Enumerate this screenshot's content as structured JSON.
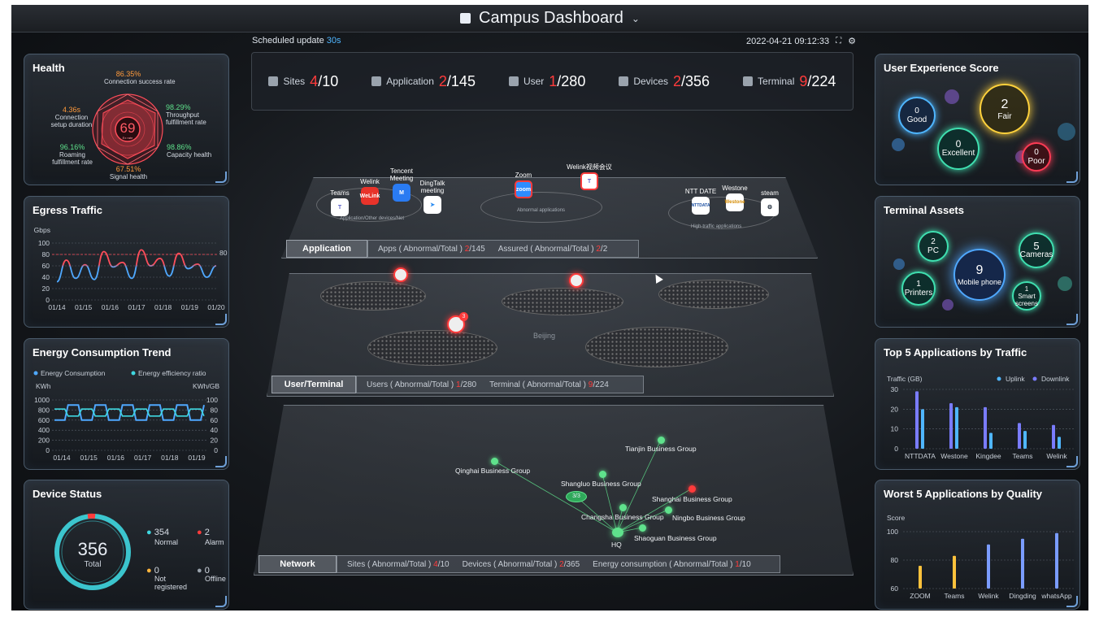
{
  "header": {
    "title": "Campus Dashboard",
    "scheduled_label": "Scheduled update",
    "scheduled_value": "30s",
    "datetime": "2022-04-21 09:12:33"
  },
  "stats": [
    {
      "label": "Sites",
      "abnormal": "4",
      "total": "/10",
      "icon": "building-icon"
    },
    {
      "label": "Application",
      "abnormal": "2",
      "total": "/145",
      "icon": "grid-icon"
    },
    {
      "label": "User",
      "abnormal": "1",
      "total": "/280",
      "icon": "person-icon"
    },
    {
      "label": "Devices",
      "abnormal": "2",
      "total": "/356",
      "icon": "server-icon"
    },
    {
      "label": "Terminal",
      "abnormal": "9",
      "total": "/224",
      "icon": "monitor-icon"
    }
  ],
  "health": {
    "title": "Health",
    "score": "69",
    "score_sub": "Ex rate",
    "metrics": {
      "conn_success": {
        "value": "86.35%",
        "label": "Connection success rate"
      },
      "setup": {
        "value": "4.36s",
        "label": "Connection setup duration"
      },
      "throughput": {
        "value": "98.29%",
        "label": "Throughput fulfillment rate"
      },
      "roaming": {
        "value": "96.16%",
        "label": "Roaming fulfillment rate"
      },
      "capacity": {
        "value": "98.86%",
        "label": "Capacity health"
      },
      "signal": {
        "value": "67.51%",
        "label": "Signal health"
      }
    }
  },
  "egress": {
    "title": "Egress Traffic",
    "unit": "Gbps",
    "threshold_label": "80"
  },
  "energy": {
    "title": "Energy Consumption Trend",
    "legend1": "Energy Consumption",
    "legend2": "Energy efficiency ratio",
    "unit_left": "KWh",
    "unit_right": "KWh/GB"
  },
  "device_status": {
    "title": "Device Status",
    "total": "356",
    "total_label": "Total",
    "normal": "354",
    "normal_label": "Normal",
    "alarm": "2",
    "alarm_label": "Alarm",
    "not_registered": "0",
    "not_registered_label": "Not registered",
    "offline": "0",
    "offline_label": "Offline"
  },
  "ux": {
    "title": "User Experience Score",
    "good": "0",
    "good_label": "Good",
    "fair": "2",
    "fair_label": "Fair",
    "excellent": "0",
    "excellent_label": "Excellent",
    "poor": "0",
    "poor_label": "Poor"
  },
  "assets": {
    "title": "Terminal Assets",
    "pc": "2",
    "pc_label": "PC",
    "cameras": "5",
    "cameras_label": "Cameras",
    "printers": "1",
    "printers_label": "Printers",
    "mobile": "9",
    "mobile_label": "Mobile phone",
    "smart": "1",
    "smart_label": "Smart screens"
  },
  "top5": {
    "title": "Top 5 Applications by Traffic",
    "unit": "Traffic (GB)",
    "uplink": "Uplink",
    "downlink": "Downlink"
  },
  "worst5": {
    "title": "Worst 5 Applications by Quality",
    "unit": "Score"
  },
  "layers": {
    "application": {
      "tab": "Application",
      "info1": "Apps ( Abnormal/Total )",
      "info1_a": "2",
      "info1_t": "/145",
      "info2": "Assured ( Abnormal/Total )",
      "info2_a": "2",
      "info2_t": "/2",
      "apps": {
        "teams": "Teams",
        "welink": "Welink",
        "tencent": "Tencent Meeting",
        "dingtalk": "DingTalk meeting",
        "zoom": "Zoom",
        "welink_video": "Welink视频会议",
        "ntt": "NTT DATE",
        "westone": "Westone",
        "steam": "steam"
      },
      "groups": {
        "g1": "Application/Other devices/Net",
        "g2": "Abnormal applications",
        "g3": "High-traffic applications"
      }
    },
    "user": {
      "tab": "User/Terminal",
      "info1": "Users ( Abnormal/Total )",
      "info1_a": "1",
      "info1_t": "/280",
      "info2": "Terminal ( Abnormal/Total )",
      "info2_a": "9",
      "info2_t": "/224",
      "city": "Beijing",
      "badge": "3"
    },
    "network": {
      "tab": "Network",
      "info1": "Sites ( Abnormal/Total )",
      "info1_a": "4",
      "info1_t": "/10",
      "info2": "Devices ( Abnormal/Total )",
      "info2_a": "2",
      "info2_t": "/365",
      "info3": "Energy consumption ( Abnormal/Total )",
      "info3_a": "1",
      "info3_t": "/10",
      "hq_badge": "3/3",
      "sites": {
        "tianjin": "Tianjin Business Group",
        "qinghai": "Qinghai Business Group",
        "shangluo": "Shangluo Business Group",
        "shanghai": "Shanghai Business Group",
        "changsha": "Changsha Business Group",
        "ningbo": "Ningbo Business Group",
        "shaoguan": "Shaoguan Business Group",
        "hq": "HQ"
      }
    }
  },
  "colors": {
    "accent": "#4fb6ff",
    "alarm": "#ff3b3b",
    "normal": "#3fd7e0",
    "ok": "#5fe28c"
  },
  "chart_data": [
    {
      "type": "line",
      "title": "Egress Traffic",
      "ylabel": "Gbps",
      "x": [
        "01/14",
        "01/15",
        "01/16",
        "01/17",
        "01/18",
        "01/19",
        "01/20"
      ],
      "ylim": [
        0,
        100
      ],
      "yticks": [
        0,
        20,
        40,
        60,
        80,
        100
      ],
      "threshold": 80,
      "series": [
        {
          "values": [
            32,
            70,
            38,
            62,
            36,
            85,
            58,
            66,
            38,
            88,
            60,
            73,
            42,
            82,
            55,
            63,
            40,
            60
          ]
        }
      ]
    },
    {
      "type": "line",
      "title": "Energy Consumption Trend",
      "x": [
        "01/14",
        "01/15",
        "01/16",
        "01/17",
        "01/18",
        "01/19"
      ],
      "ylim": [
        0,
        1000
      ],
      "ylim_right": [
        0,
        100
      ],
      "yticks": [
        0,
        200,
        400,
        600,
        800,
        1000
      ],
      "yticks_right": [
        0,
        20,
        40,
        60,
        80,
        100
      ],
      "series": [
        {
          "name": "Energy Consumption",
          "values": [
            600,
            900,
            600,
            900,
            600,
            900,
            600,
            900,
            600,
            900,
            600,
            900
          ]
        },
        {
          "name": "Energy efficiency ratio",
          "values": [
            82,
            68,
            82,
            68,
            82,
            68,
            82,
            68,
            82,
            68,
            82,
            68
          ]
        }
      ]
    },
    {
      "type": "bar",
      "title": "Top 5 Applications by Traffic",
      "ylabel": "Traffic (GB)",
      "categories": [
        "NTTDATA",
        "Westone",
        "Kingdee",
        "Teams",
        "Welink"
      ],
      "ylim": [
        0,
        30
      ],
      "yticks": [
        0,
        10,
        20,
        30
      ],
      "series": [
        {
          "name": "Uplink",
          "values": [
            29,
            23,
            21,
            13,
            12
          ]
        },
        {
          "name": "Downlink",
          "values": [
            20,
            21,
            8,
            9,
            6
          ]
        }
      ]
    },
    {
      "type": "bar",
      "title": "Worst 5 Applications by Quality",
      "ylabel": "Score",
      "categories": [
        "ZOOM",
        "Teams",
        "Welink",
        "Dingding",
        "whatsApp"
      ],
      "ylim": [
        60,
        100
      ],
      "yticks": [
        60,
        80,
        100
      ],
      "series": [
        {
          "values": [
            76,
            83,
            91,
            95,
            99
          ]
        }
      ]
    }
  ]
}
